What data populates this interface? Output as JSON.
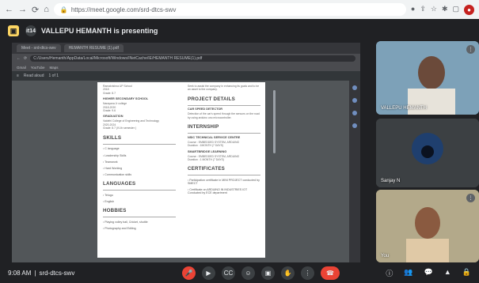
{
  "browser": {
    "url": "https://meet.google.com/srd-dtcs-swv",
    "icons": [
      "back-icon",
      "forward-icon",
      "reload-icon",
      "home-icon"
    ]
  },
  "meet": {
    "presenter_label": "VALLEPU HEMANTH is presenting",
    "presenter_prefix": "it14"
  },
  "shared": {
    "tabs": [
      "Meet - srd-dtcs-swv",
      "HEMANTH RESUME (1).pdf"
    ],
    "url": "C:/Users/Hemanth/AppData/Local/Microsoft/Windows/INetCache/IE/HEMANTH RESUME(1).pdf",
    "bookmarks": [
      "Gmail",
      "YouTube",
      "Maps"
    ],
    "pdf_title": "Read aloud",
    "page_label": "1 of 1"
  },
  "resume": {
    "left": {
      "school_lines": [
        "Ramakrishna UP School",
        "2018",
        "Grade: 8.7"
      ],
      "higher_secondary_title": "HIGHER SECONDARY SCHOOL",
      "higher_secondary_lines": [
        "Narayana Jr college",
        "2018-2020",
        "Grade: 9.6"
      ],
      "graduation_label": "GRADUATION",
      "graduation_lines": [
        "Vaidehi College of Engineering and Technology",
        "2020-2024",
        "Grade: 8.7 (IV-th semester )"
      ],
      "skills_title": "SKILLS",
      "skills": [
        "C language",
        "Leadership Skills",
        "Teamwork",
        "Hard Working",
        "Communication skills"
      ],
      "languages_title": "LANGUAGES",
      "languages": [
        "Telugu",
        "English"
      ],
      "hobbies_title": "HOBBIES",
      "hobbies": [
        "Playing volley ball, Cricket, shuttle",
        "Photography and Editing"
      ]
    },
    "right": {
      "intro": "Seek to assist the company in enhancing its goals and to be an asset to the company.",
      "project_title": "PROJECT DETAILS",
      "project_name": "CAR SPEED DETECTOR",
      "project_desc": "Detection of the car's speed through the sensors on the road by using arduino uno microcontroller.",
      "internship_title": "INTERNSHIP",
      "intern1_title": "NSIC TECHNICAL SERVICE CENTRE",
      "intern1_lines": [
        "Course : EMBEDDED SYSTEM, ARDUINO",
        "Duration : 1MONTH (7 DAYS)"
      ],
      "intern2_title": "SMARTBRIDGE LEARNING",
      "intern2_lines": [
        "Course : EMBEDDED SYSTEM, ARDUINO",
        "Duration : 1 MONTH (7 DAYS)"
      ],
      "certificates_title": "CERTIFICATES",
      "certificates": [
        "Participation certificate in MINI PROJECT conducted by SMECT",
        "Certificate on ARDUINO IN INDUSTRIES IOT Conducted by ECE department"
      ]
    }
  },
  "participants": [
    {
      "name": "VALLEPU HEMANTH"
    },
    {
      "name": "Sanjay N"
    },
    {
      "name": "You"
    }
  ],
  "bottom": {
    "time": "9:08 AM",
    "separator": "|",
    "code": "srd-dtcs-swv"
  },
  "colors": {
    "accent": "#8ab4f8",
    "hangup": "#ea4335",
    "badge": "#fdd663"
  }
}
